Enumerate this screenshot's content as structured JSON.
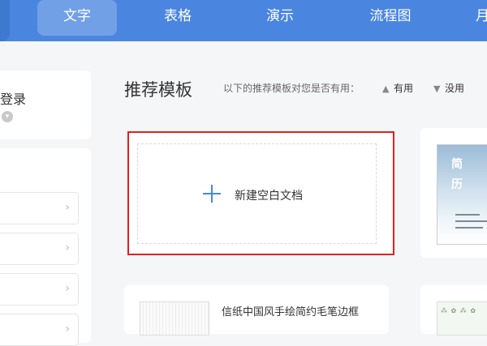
{
  "tabs": [
    {
      "label": "文字"
    },
    {
      "label": "表格"
    },
    {
      "label": "演示"
    },
    {
      "label": "流程图"
    },
    {
      "label": "月"
    }
  ],
  "active_tab": "文字",
  "login": {
    "label": "登录",
    "icon": "chevron-down-icon"
  },
  "recommend": {
    "title": "推荐模板",
    "question": "以下的推荐模板对您是否有用：",
    "useful_label": "有用",
    "useless_label": "没用",
    "useful_icon": "thumbs-up-icon",
    "useless_icon": "thumbs-down-icon"
  },
  "blank_doc": {
    "label": "新建空白文档",
    "icon": "plus-icon",
    "highlight_color": "#e02020"
  },
  "resume_template": {
    "title_chars": [
      "简",
      "历"
    ]
  },
  "bottom_template": {
    "label": "信纸中国风手绘简约毛笔边框"
  },
  "colors": {
    "accent": "#4a86e0"
  }
}
